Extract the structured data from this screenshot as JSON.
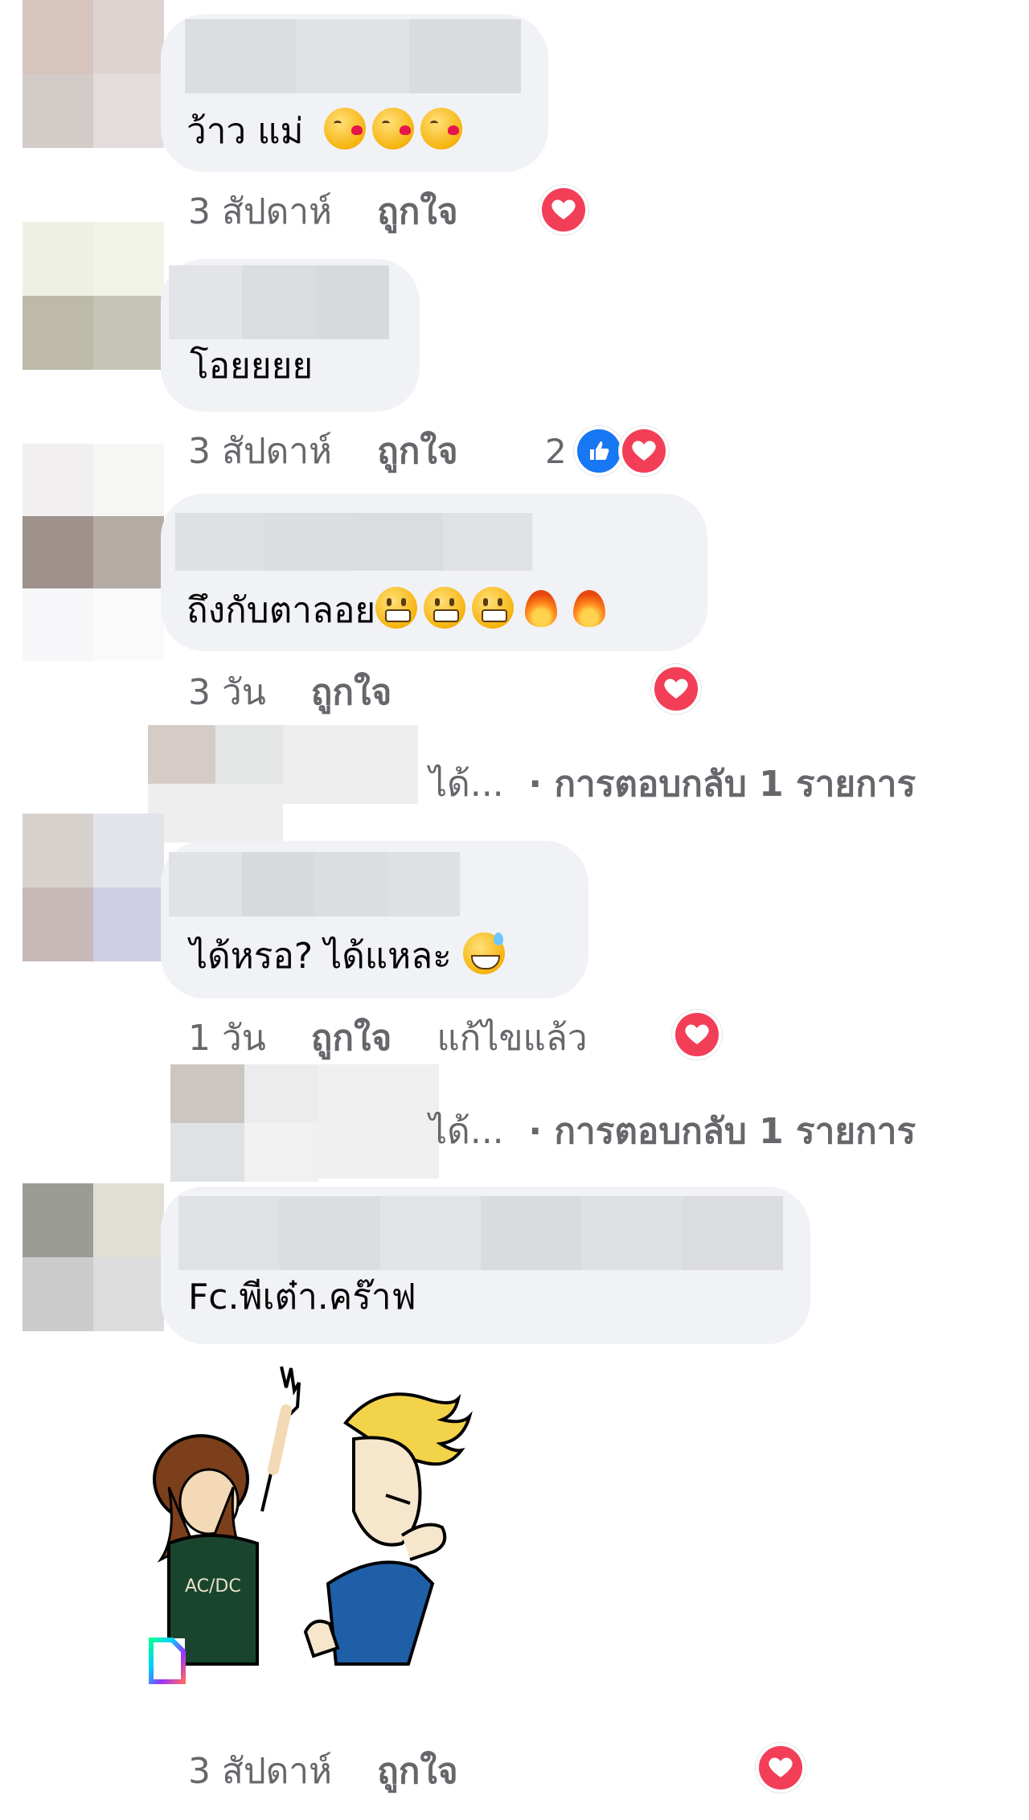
{
  "comments": [
    {
      "text": "ว้าว แม่",
      "emojis": [
        "kiss-emoji",
        "kiss-emoji",
        "kiss-emoji"
      ],
      "meta": {
        "time": "3 สัปดาห์",
        "like": "ถูกใจ"
      },
      "reactions": [
        "love"
      ],
      "avatar_colors": [
        "#d6c4bd",
        "#ddd4d2",
        "#d3cbc8",
        "#e3dcdc"
      ]
    },
    {
      "text": "โอยยยย",
      "emojis": [],
      "meta": {
        "time": "3 สัปดาห์",
        "like": "ถูกใจ"
      },
      "reaction_count": "2",
      "reactions": [
        "like",
        "love"
      ],
      "avatar_colors": [
        "#eef0e4",
        "#f1f2e8",
        "#bdbaa8",
        "#c6c4b6"
      ]
    },
    {
      "text": "ถึงกับตาลอย",
      "emojis": [
        "grimace-emoji",
        "grimace-emoji",
        "grimace-emoji",
        "fire-emoji",
        "fire-emoji"
      ],
      "meta": {
        "time": "3 วัน",
        "like": "ถูกใจ"
      },
      "reactions": [
        "love"
      ],
      "avatar_colors": [
        "#9f918b",
        "#b4aba5",
        "#f3f3f5",
        "#f6f6f7"
      ],
      "reply_summary": {
        "truncated": "ได้...",
        "label": "· การตอบกลับ 1 รายการ"
      },
      "reply_avatar_colors": [
        "#d5ccc8",
        "#e4e6e6",
        "#eeeeee",
        "#eeeeef"
      ]
    },
    {
      "text": "ได้หรอ? ได้แหละ",
      "emojis": [
        "sweat-smile-emoji"
      ],
      "meta": {
        "time": "1 วัน",
        "like": "ถูกใจ",
        "edited": "แก้ไขแล้ว"
      },
      "reactions": [
        "love"
      ],
      "avatar_colors": [
        "#d8d2ce",
        "#e2e4ea",
        "#c6b9b8",
        "#d0cde6"
      ],
      "reply_summary": {
        "truncated": "ได้...",
        "label": "· การตอบกลับ 1 รายการ"
      },
      "reply_avatar_colors": [
        "#ccc6c2",
        "#ececec",
        "#dfe2e5",
        "#f1f1f2"
      ]
    },
    {
      "text": "Fc.พีเต๋า.คร๊าฟ",
      "emojis": [],
      "meta": {
        "time": "3 สัปดาห์",
        "like": "ถูกใจ"
      },
      "reactions": [
        "love"
      ],
      "attachment": "gif-sticker",
      "avatar_colors": [
        "#9b9d95",
        "#e1dfd5",
        "#cbcbcb",
        "#dcdcdc"
      ]
    }
  ],
  "colors": {
    "bubble": "#f0f2f5",
    "meta_text": "#65676b",
    "love": "#f33e58",
    "like": "#1877f2"
  }
}
